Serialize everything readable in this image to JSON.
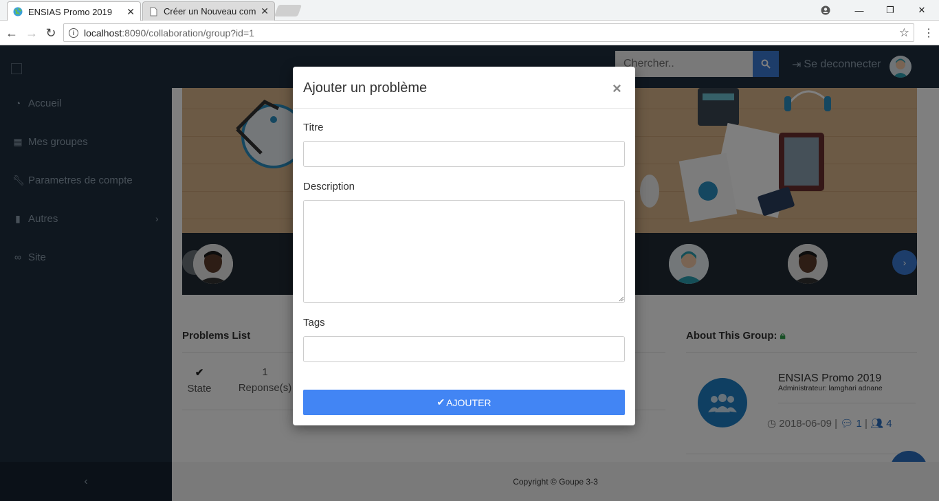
{
  "browser": {
    "tabs": [
      {
        "title": "ENSIAS Promo 2019",
        "active": true
      },
      {
        "title": "Créer un Nouveau compte",
        "active": false
      }
    ],
    "url_host": "localhost",
    "url_path": ":8090/collaboration/group?id=1"
  },
  "sidebar": {
    "items": [
      {
        "label": "Accueil",
        "icon": "dashboard-icon"
      },
      {
        "label": "Mes groupes",
        "icon": "table-icon"
      },
      {
        "label": "Parametres de compte",
        "icon": "wrench-icon"
      },
      {
        "label": "Autres",
        "icon": "file-icon"
      },
      {
        "label": "Site",
        "icon": "link-icon"
      }
    ],
    "collapse_icon": "chevron-left-icon"
  },
  "topbar": {
    "search_placeholder": "Chercher..",
    "logout_label": "Se deconnecter"
  },
  "page": {
    "problems_title": "Problems List",
    "state_label": "State",
    "responses_count": "1",
    "responses_label": "Reponse(s)",
    "about_title": "About This Group:",
    "group_name": "ENSIAS Promo 2019",
    "group_admin": "Administrateur: lamghari adnane",
    "group_date": "2018-06-09",
    "group_comments": "1",
    "group_members": "4",
    "sep": "|",
    "footer": "Copyright © Goupe 3-3"
  },
  "modal": {
    "title": "Ajouter un problème",
    "close": "×",
    "titre_label": "Titre",
    "titre_value": "",
    "description_label": "Description",
    "description_value": "",
    "tags_label": "Tags",
    "tags_value": "",
    "submit_label": "AJOUTER"
  },
  "colors": {
    "sidebar": "#1f2f3f",
    "accent": "#4285f4",
    "link": "#2a6fc0"
  }
}
